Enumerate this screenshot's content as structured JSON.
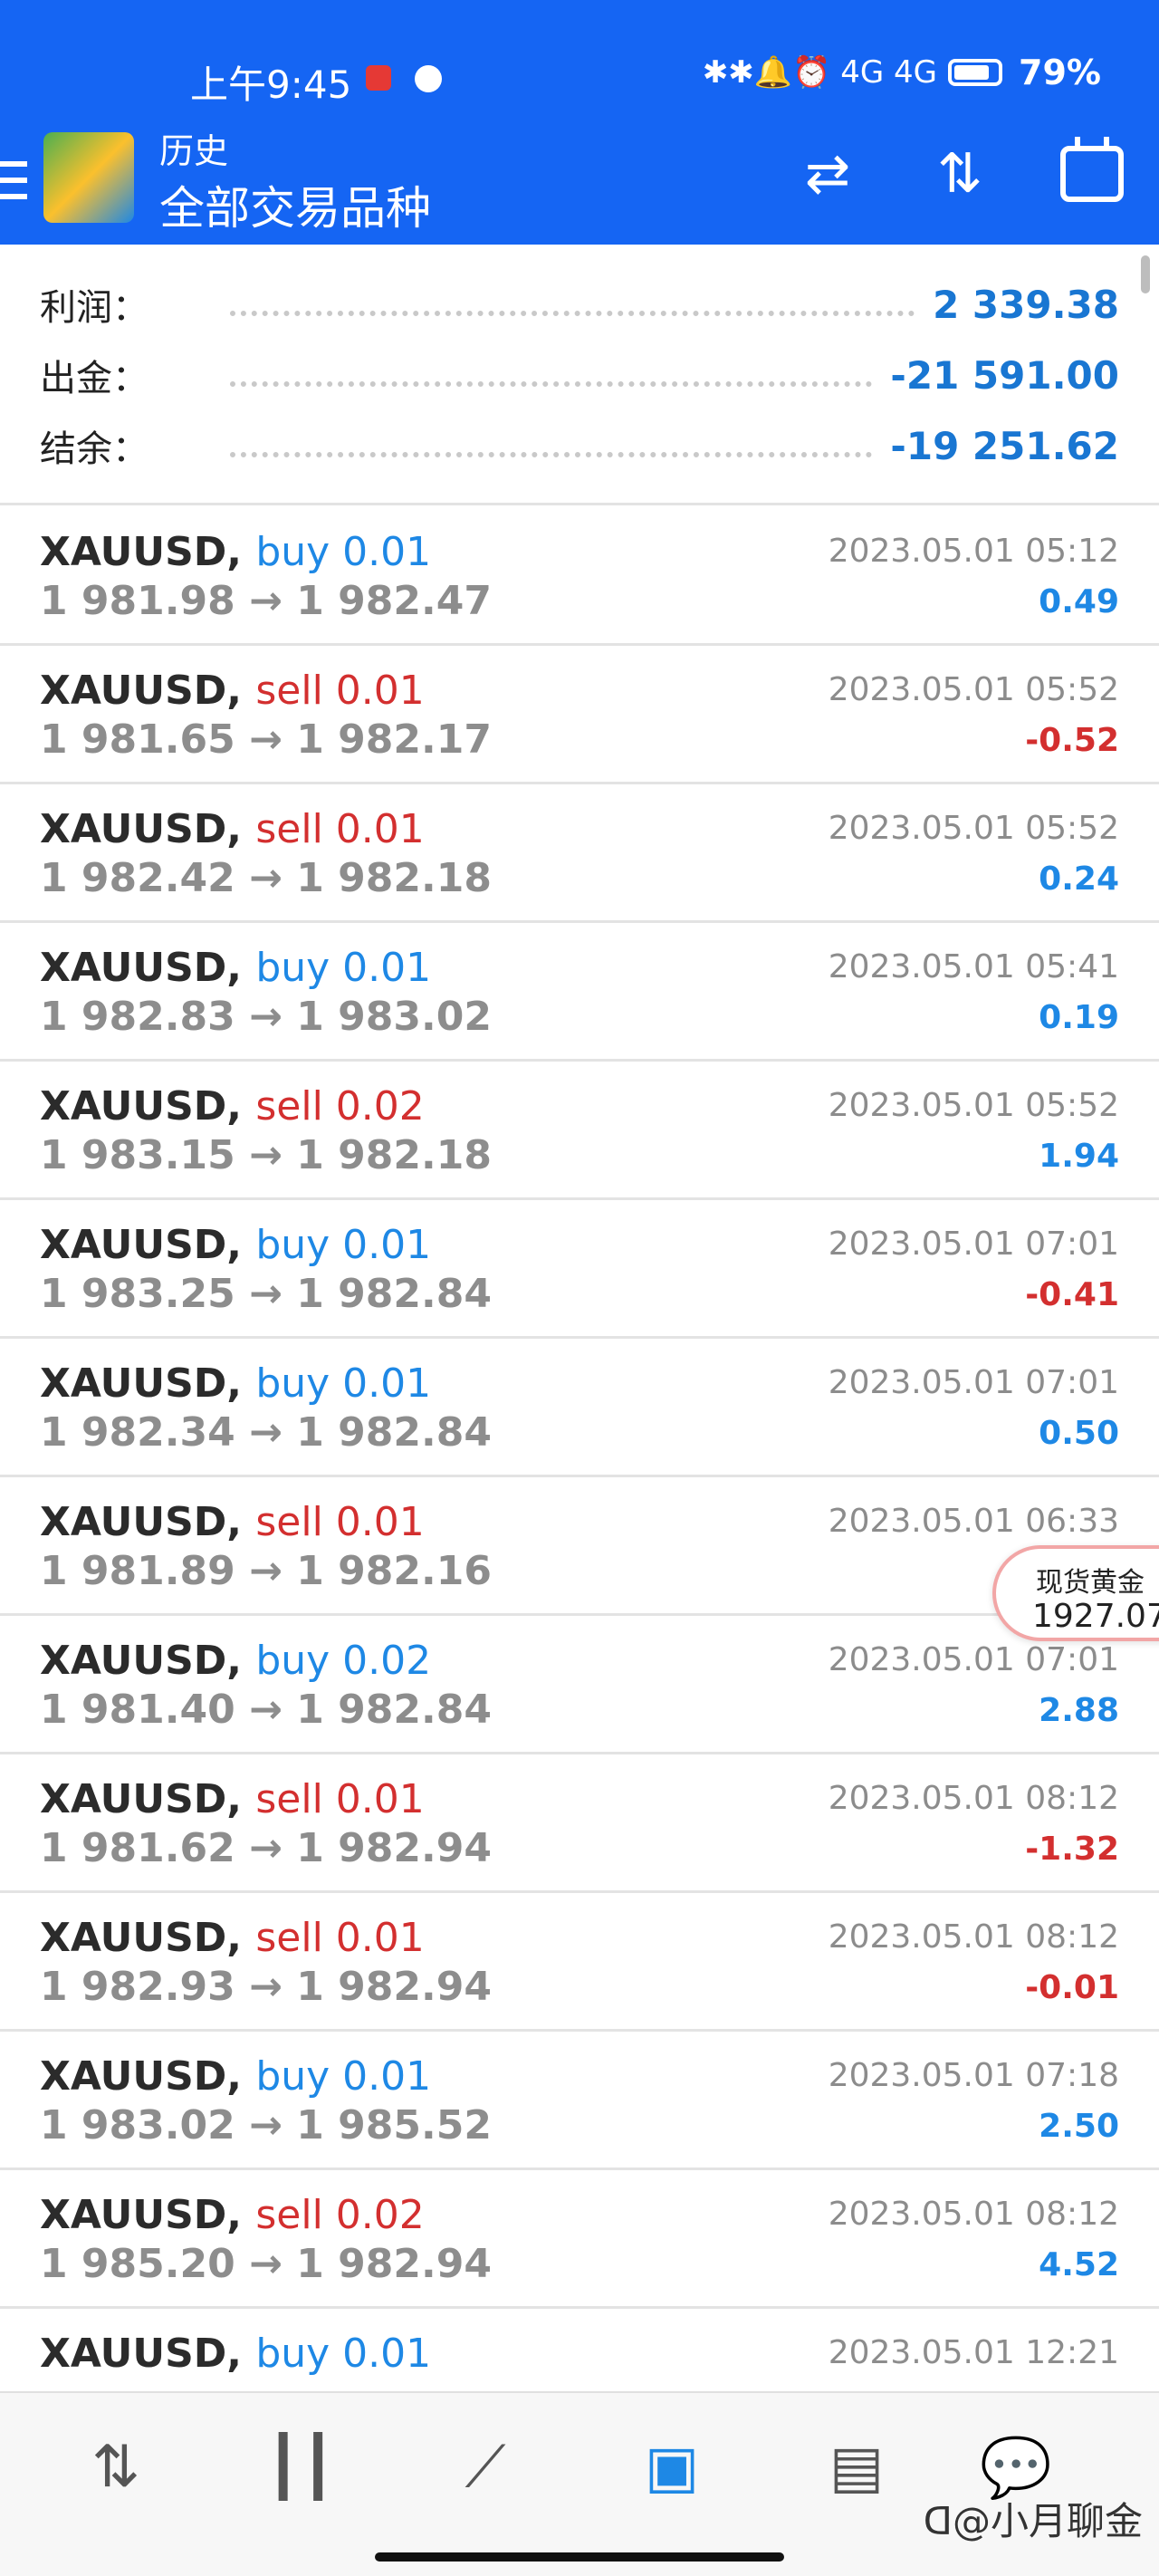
{
  "status_bar": {
    "time": "上午9:45",
    "signal": "✱✱🔔⏰ 4G 4G",
    "battery": "79%"
  },
  "header": {
    "subtitle": "历史",
    "title": "全部交易品种",
    "icons": [
      "menu-icon",
      "app-logo",
      "currency-exchange-icon",
      "sort-icon",
      "calendar-icon"
    ]
  },
  "summary": {
    "profit_label": "利润：",
    "profit_value": "2 339.38",
    "withdraw_label": "出金：",
    "withdraw_value": "-21 591.00",
    "balance_label": "结余：",
    "balance_value": "-19 251.62"
  },
  "trades": [
    {
      "symbol": "XAUUSD,",
      "action": "buy 0.01",
      "side": "buy",
      "open": "1 981.98",
      "close": "1 982.47",
      "datetime": "2023.05.01 05:12",
      "pnl": "0.49",
      "pnl_sign": "pos"
    },
    {
      "symbol": "XAUUSD,",
      "action": "sell 0.01",
      "side": "sell",
      "open": "1 981.65",
      "close": "1 982.17",
      "datetime": "2023.05.01 05:52",
      "pnl": "-0.52",
      "pnl_sign": "neg"
    },
    {
      "symbol": "XAUUSD,",
      "action": "sell 0.01",
      "side": "sell",
      "open": "1 982.42",
      "close": "1 982.18",
      "datetime": "2023.05.01 05:52",
      "pnl": "0.24",
      "pnl_sign": "pos"
    },
    {
      "symbol": "XAUUSD,",
      "action": "buy 0.01",
      "side": "buy",
      "open": "1 982.83",
      "close": "1 983.02",
      "datetime": "2023.05.01 05:41",
      "pnl": "0.19",
      "pnl_sign": "pos"
    },
    {
      "symbol": "XAUUSD,",
      "action": "sell 0.02",
      "side": "sell",
      "open": "1 983.15",
      "close": "1 982.18",
      "datetime": "2023.05.01 05:52",
      "pnl": "1.94",
      "pnl_sign": "pos"
    },
    {
      "symbol": "XAUUSD,",
      "action": "buy 0.01",
      "side": "buy",
      "open": "1 983.25",
      "close": "1 982.84",
      "datetime": "2023.05.01 07:01",
      "pnl": "-0.41",
      "pnl_sign": "neg"
    },
    {
      "symbol": "XAUUSD,",
      "action": "buy 0.01",
      "side": "buy",
      "open": "1 982.34",
      "close": "1 982.84",
      "datetime": "2023.05.01 07:01",
      "pnl": "0.50",
      "pnl_sign": "pos"
    },
    {
      "symbol": "XAUUSD,",
      "action": "sell 0.01",
      "side": "sell",
      "open": "1 981.89",
      "close": "1 982.16",
      "datetime": "2023.05.01 06:33",
      "pnl": "",
      "pnl_sign": "neg"
    },
    {
      "symbol": "XAUUSD,",
      "action": "buy 0.02",
      "side": "buy",
      "open": "1 981.40",
      "close": "1 982.84",
      "datetime": "2023.05.01 07:01",
      "pnl": "2.88",
      "pnl_sign": "pos"
    },
    {
      "symbol": "XAUUSD,",
      "action": "sell 0.01",
      "side": "sell",
      "open": "1 981.62",
      "close": "1 982.94",
      "datetime": "2023.05.01 08:12",
      "pnl": "-1.32",
      "pnl_sign": "neg"
    },
    {
      "symbol": "XAUUSD,",
      "action": "sell 0.01",
      "side": "sell",
      "open": "1 982.93",
      "close": "1 982.94",
      "datetime": "2023.05.01 08:12",
      "pnl": "-0.01",
      "pnl_sign": "neg"
    },
    {
      "symbol": "XAUUSD,",
      "action": "buy 0.01",
      "side": "buy",
      "open": "1 983.02",
      "close": "1 985.52",
      "datetime": "2023.05.01 07:18",
      "pnl": "2.50",
      "pnl_sign": "pos"
    },
    {
      "symbol": "XAUUSD,",
      "action": "sell 0.02",
      "side": "sell",
      "open": "1 985.20",
      "close": "1 982.94",
      "datetime": "2023.05.01 08:12",
      "pnl": "4.52",
      "pnl_sign": "pos"
    },
    {
      "symbol": "XAUUSD,",
      "action": "buy 0.01",
      "side": "buy",
      "open": "",
      "close": "",
      "datetime": "2023.05.01 12:21",
      "pnl": "",
      "pnl_sign": "neg"
    }
  ],
  "floating_quote": {
    "name": "现货黄金",
    "value": "1927.07"
  },
  "bottom_nav": {
    "items": [
      "quotes-icon",
      "chart-icon",
      "trade-icon",
      "history-icon",
      "news-icon",
      "chat-icon"
    ],
    "active": "history-icon",
    "watermark": "ᗡ@小月聊金"
  },
  "colors": {
    "header_bg": "#1565f3",
    "positive": "#1e88e5",
    "negative": "#d32f2f"
  }
}
